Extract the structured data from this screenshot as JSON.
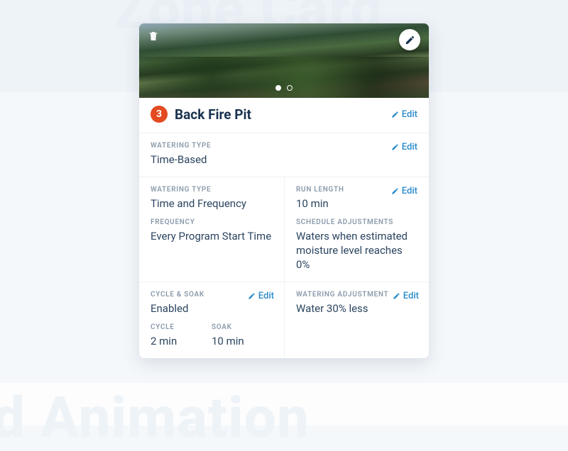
{
  "watermark": {
    "top": "Zone Card",
    "bottom": "rd Animation"
  },
  "zone": {
    "number": "3",
    "title": "Back Fire Pit"
  },
  "actions": {
    "edit": "Edit"
  },
  "sections": {
    "wateringType": {
      "label": "WATERING TYPE",
      "value": "Time-Based"
    },
    "schedule": {
      "left": {
        "typeLabel": "WATERING TYPE",
        "typeValue": "Time and Frequency",
        "freqLabel": "FREQUENCY",
        "freqValue": "Every Program Start Time"
      },
      "right": {
        "runLabel": "RUN LENGTH",
        "runValue": "10 min",
        "adjLabel": "SCHEDULE ADJUSTMENTS",
        "adjValue": "Waters when estimated moisture level reaches 0%"
      }
    },
    "cycleSoak": {
      "label": "CYCLE & SOAK",
      "value": "Enabled",
      "cycleLabel": "CYCLE",
      "cycleValue": "2 min",
      "soakLabel": "SOAK",
      "soakValue": "10 min"
    },
    "adjustment": {
      "label": "WATERING ADJUSTMENT",
      "value": "Water 30% less"
    }
  }
}
